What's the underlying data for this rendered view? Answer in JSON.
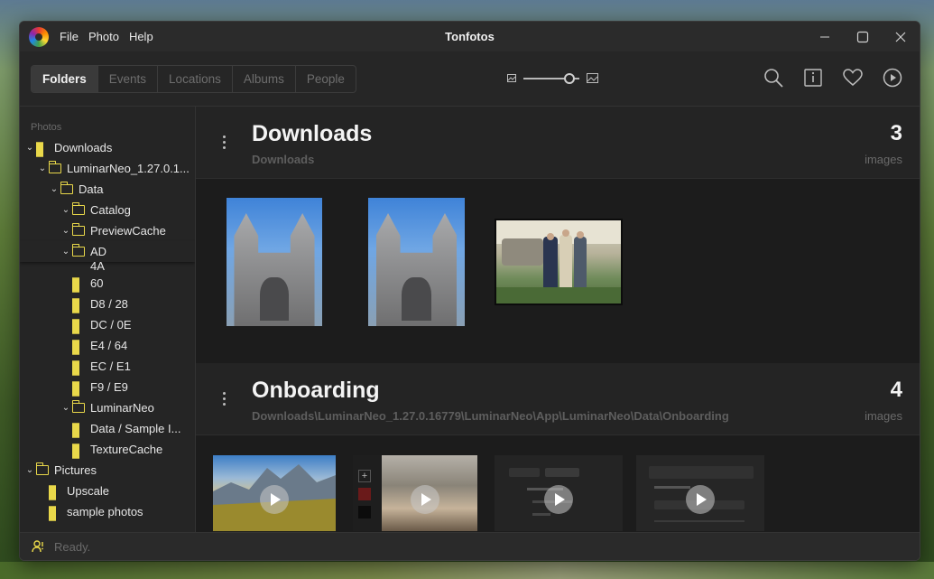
{
  "app": {
    "title": "Tonfotos",
    "menu": [
      "File",
      "Photo",
      "Help"
    ]
  },
  "toolbar": {
    "tabs": [
      {
        "label": "Folders",
        "active": true
      },
      {
        "label": "Events",
        "active": false
      },
      {
        "label": "Locations",
        "active": false
      },
      {
        "label": "Albums",
        "active": false
      },
      {
        "label": "People",
        "active": false
      }
    ],
    "zoom_level": 0.9,
    "icons": [
      "search-icon",
      "info-icon",
      "heart-icon",
      "play-icon"
    ]
  },
  "sidebar": {
    "header": "Photos",
    "items": [
      {
        "label": "Downloads",
        "icon": "grid-icon",
        "expanded": true
      },
      {
        "label": "LuminarNeo_1.27.0.1...",
        "icon": "folder-icon",
        "expanded": true
      },
      {
        "label": "Data",
        "icon": "folder-icon",
        "expanded": true
      },
      {
        "label": "Catalog",
        "icon": "folder-icon",
        "expanded": true
      },
      {
        "label": "PreviewCache",
        "icon": "folder-icon",
        "expanded": true
      },
      {
        "label": "AD",
        "icon": "folder-icon",
        "expanded": true
      },
      {
        "label": "4A",
        "icon": "grid-icon"
      },
      {
        "label": "60",
        "icon": "grid-icon"
      },
      {
        "label": "D8 / 28",
        "icon": "grid-icon"
      },
      {
        "label": "DC / 0E",
        "icon": "grid-icon"
      },
      {
        "label": "E4 / 64",
        "icon": "grid-icon"
      },
      {
        "label": "EC / E1",
        "icon": "grid-icon"
      },
      {
        "label": "F9 / E9",
        "icon": "grid-icon"
      },
      {
        "label": "LuminarNeo",
        "icon": "folder-icon",
        "expanded": true
      },
      {
        "label": "Data / Sample I...",
        "icon": "grid-icon"
      },
      {
        "label": "TextureCache",
        "icon": "grid-icon"
      },
      {
        "label": "Pictures",
        "icon": "folder-icon",
        "expanded": true
      },
      {
        "label": "Upscale",
        "icon": "grid-icon"
      },
      {
        "label": "sample photos",
        "icon": "grid-icon"
      }
    ]
  },
  "sections": [
    {
      "title": "Downloads",
      "path": "Downloads",
      "count": "3",
      "unit": "images"
    },
    {
      "title": "Onboarding",
      "path": "Downloads\\LuminarNeo_1.27.0.16779\\LuminarNeo\\App\\LuminarNeo\\Data\\Onboarding",
      "count": "4",
      "unit": "images"
    }
  ],
  "status": {
    "text": "Ready."
  }
}
